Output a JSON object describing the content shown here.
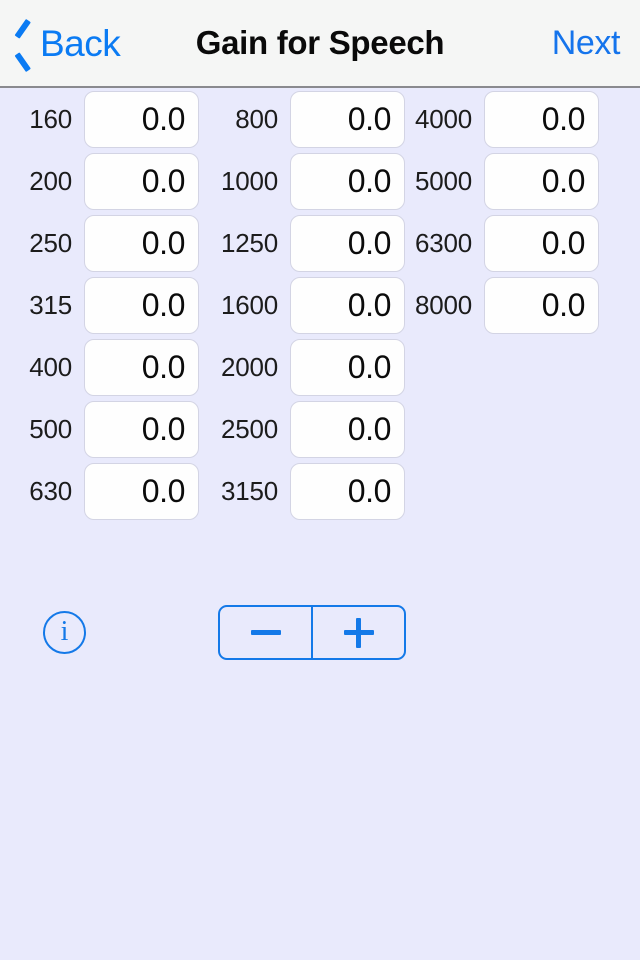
{
  "navbar": {
    "back_label": "Back",
    "title": "Gain for Speech",
    "next_label": "Next",
    "back_icon": "chevron-left-icon",
    "accent_color": "#0b7bf3",
    "title_color": "#0a0a0a",
    "background_color": "#f5f6f5"
  },
  "theme": {
    "page_background": "#e9eafc",
    "field_background": "#fefefe",
    "field_border": "#d3d4e4",
    "control_blue": "#1479e8"
  },
  "gain_columns": [
    {
      "rows": [
        {
          "frequency": "160",
          "value": "0.0"
        },
        {
          "frequency": "200",
          "value": "0.0"
        },
        {
          "frequency": "250",
          "value": "0.0"
        },
        {
          "frequency": "315",
          "value": "0.0"
        },
        {
          "frequency": "400",
          "value": "0.0"
        },
        {
          "frequency": "500",
          "value": "0.0"
        },
        {
          "frequency": "630",
          "value": "0.0"
        }
      ]
    },
    {
      "rows": [
        {
          "frequency": "800",
          "value": "0.0"
        },
        {
          "frequency": "1000",
          "value": "0.0"
        },
        {
          "frequency": "1250",
          "value": "0.0"
        },
        {
          "frequency": "1600",
          "value": "0.0"
        },
        {
          "frequency": "2000",
          "value": "0.0"
        },
        {
          "frequency": "2500",
          "value": "0.0"
        },
        {
          "frequency": "3150",
          "value": "0.0"
        }
      ]
    },
    {
      "rows": [
        {
          "frequency": "4000",
          "value": "0.0"
        },
        {
          "frequency": "5000",
          "value": "0.0"
        },
        {
          "frequency": "6300",
          "value": "0.0"
        },
        {
          "frequency": "8000",
          "value": "0.0"
        }
      ]
    }
  ],
  "controls": {
    "info_icon": "info-circle-icon",
    "info_glyph": "i",
    "stepper": {
      "decrement_icon": "minus-icon",
      "increment_icon": "plus-icon"
    }
  }
}
